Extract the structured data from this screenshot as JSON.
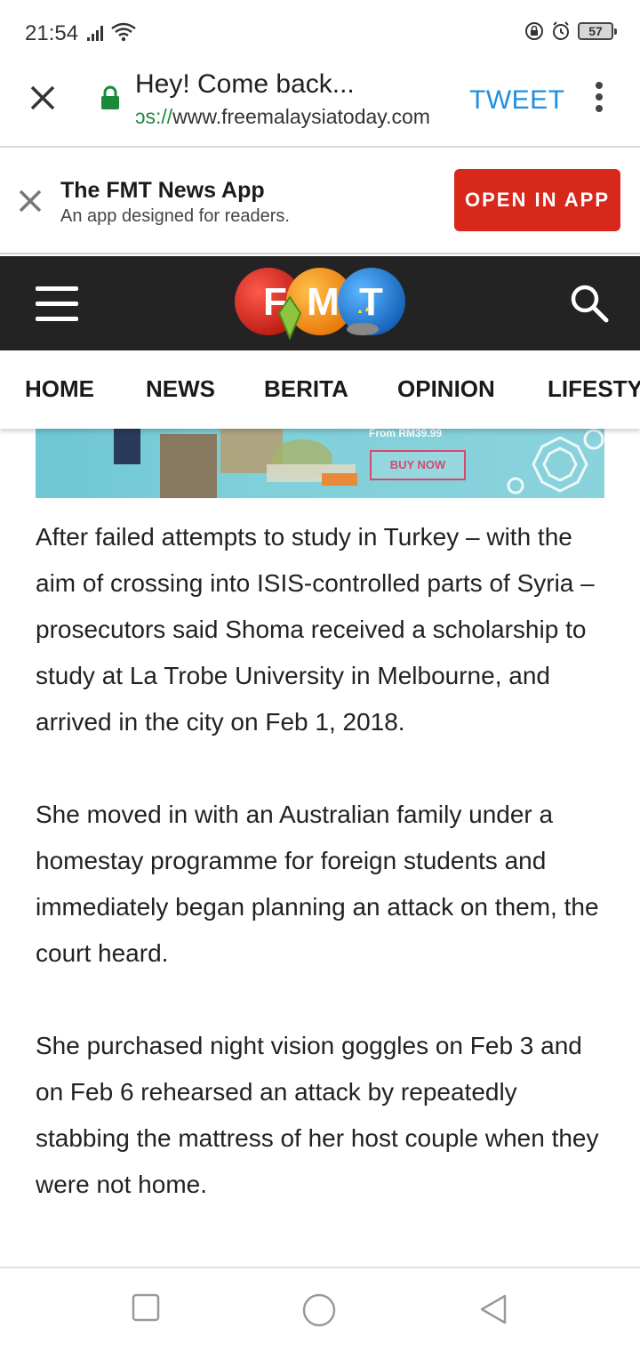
{
  "status_bar": {
    "time": "21:54",
    "battery": "57"
  },
  "url_bar": {
    "page_title": "Hey! Come back...",
    "url_scheme": "ɔs://",
    "url_host": "www.freemalaysiatoday.com",
    "tweet_label": "TWEET"
  },
  "app_banner": {
    "title": "The FMT News App",
    "subtitle": "An app designed for readers.",
    "open_button": "OPEN IN APP"
  },
  "header": {
    "logo_text": [
      "F",
      "M",
      "T"
    ]
  },
  "nav": {
    "items": [
      "HOME",
      "NEWS",
      "BERITA",
      "OPINION",
      "LIFESTY"
    ]
  },
  "ad": {
    "price": "From RM39.99",
    "cta": "BUY NOW"
  },
  "article": {
    "paragraphs": [
      "After failed attempts to study in Turkey – with the aim of crossing into ISIS-controlled parts of Syria – prosecutors said Shoma received a scholarship to study at La Trobe University in Melbourne, and arrived in the city on Feb 1, 2018.",
      "She moved in with an Australian family under a homestay programme for foreign students and immediately began planning an attack on them, the court heard.",
      "She purchased night vision goggles on Feb 3 and on Feb 6 rehearsed an attack by repeatedly stabbing the mattress of her host couple when they were not home."
    ]
  },
  "colors": {
    "accent_blue": "#1e8fe0",
    "brand_red": "#d8281c",
    "header_dark": "#232323"
  }
}
